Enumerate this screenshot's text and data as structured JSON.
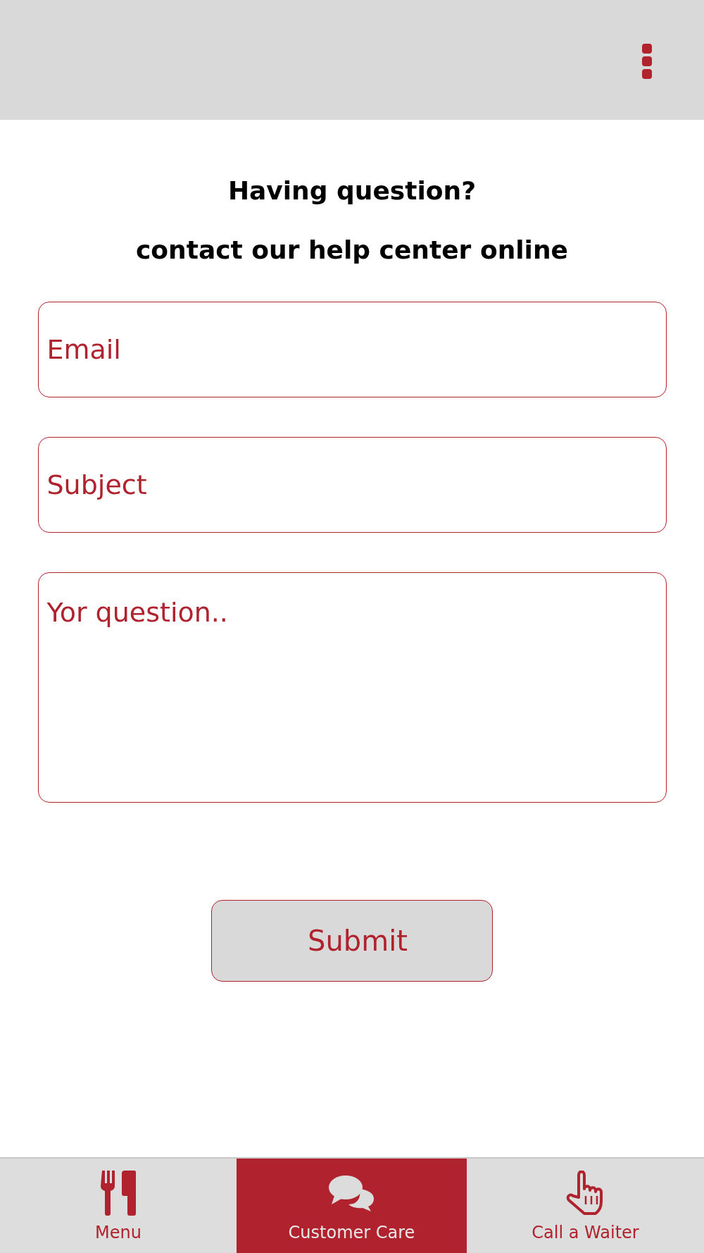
{
  "heading": [
    "Having question?",
    "contact our help center online"
  ],
  "form": {
    "fields": [
      {
        "kind": "input",
        "placeholder": "Email"
      },
      {
        "kind": "input",
        "placeholder": "Subject"
      },
      {
        "kind": "textarea",
        "placeholder": "Yor question.."
      }
    ],
    "submit": "Submit"
  },
  "tabs": [
    {
      "kind": "cutlery",
      "label": "Menu",
      "selected": false
    },
    {
      "kind": "chat",
      "label": "Customer Care",
      "selected": true
    },
    {
      "kind": "hand",
      "label": "Call a Waiter",
      "selected": false
    }
  ]
}
